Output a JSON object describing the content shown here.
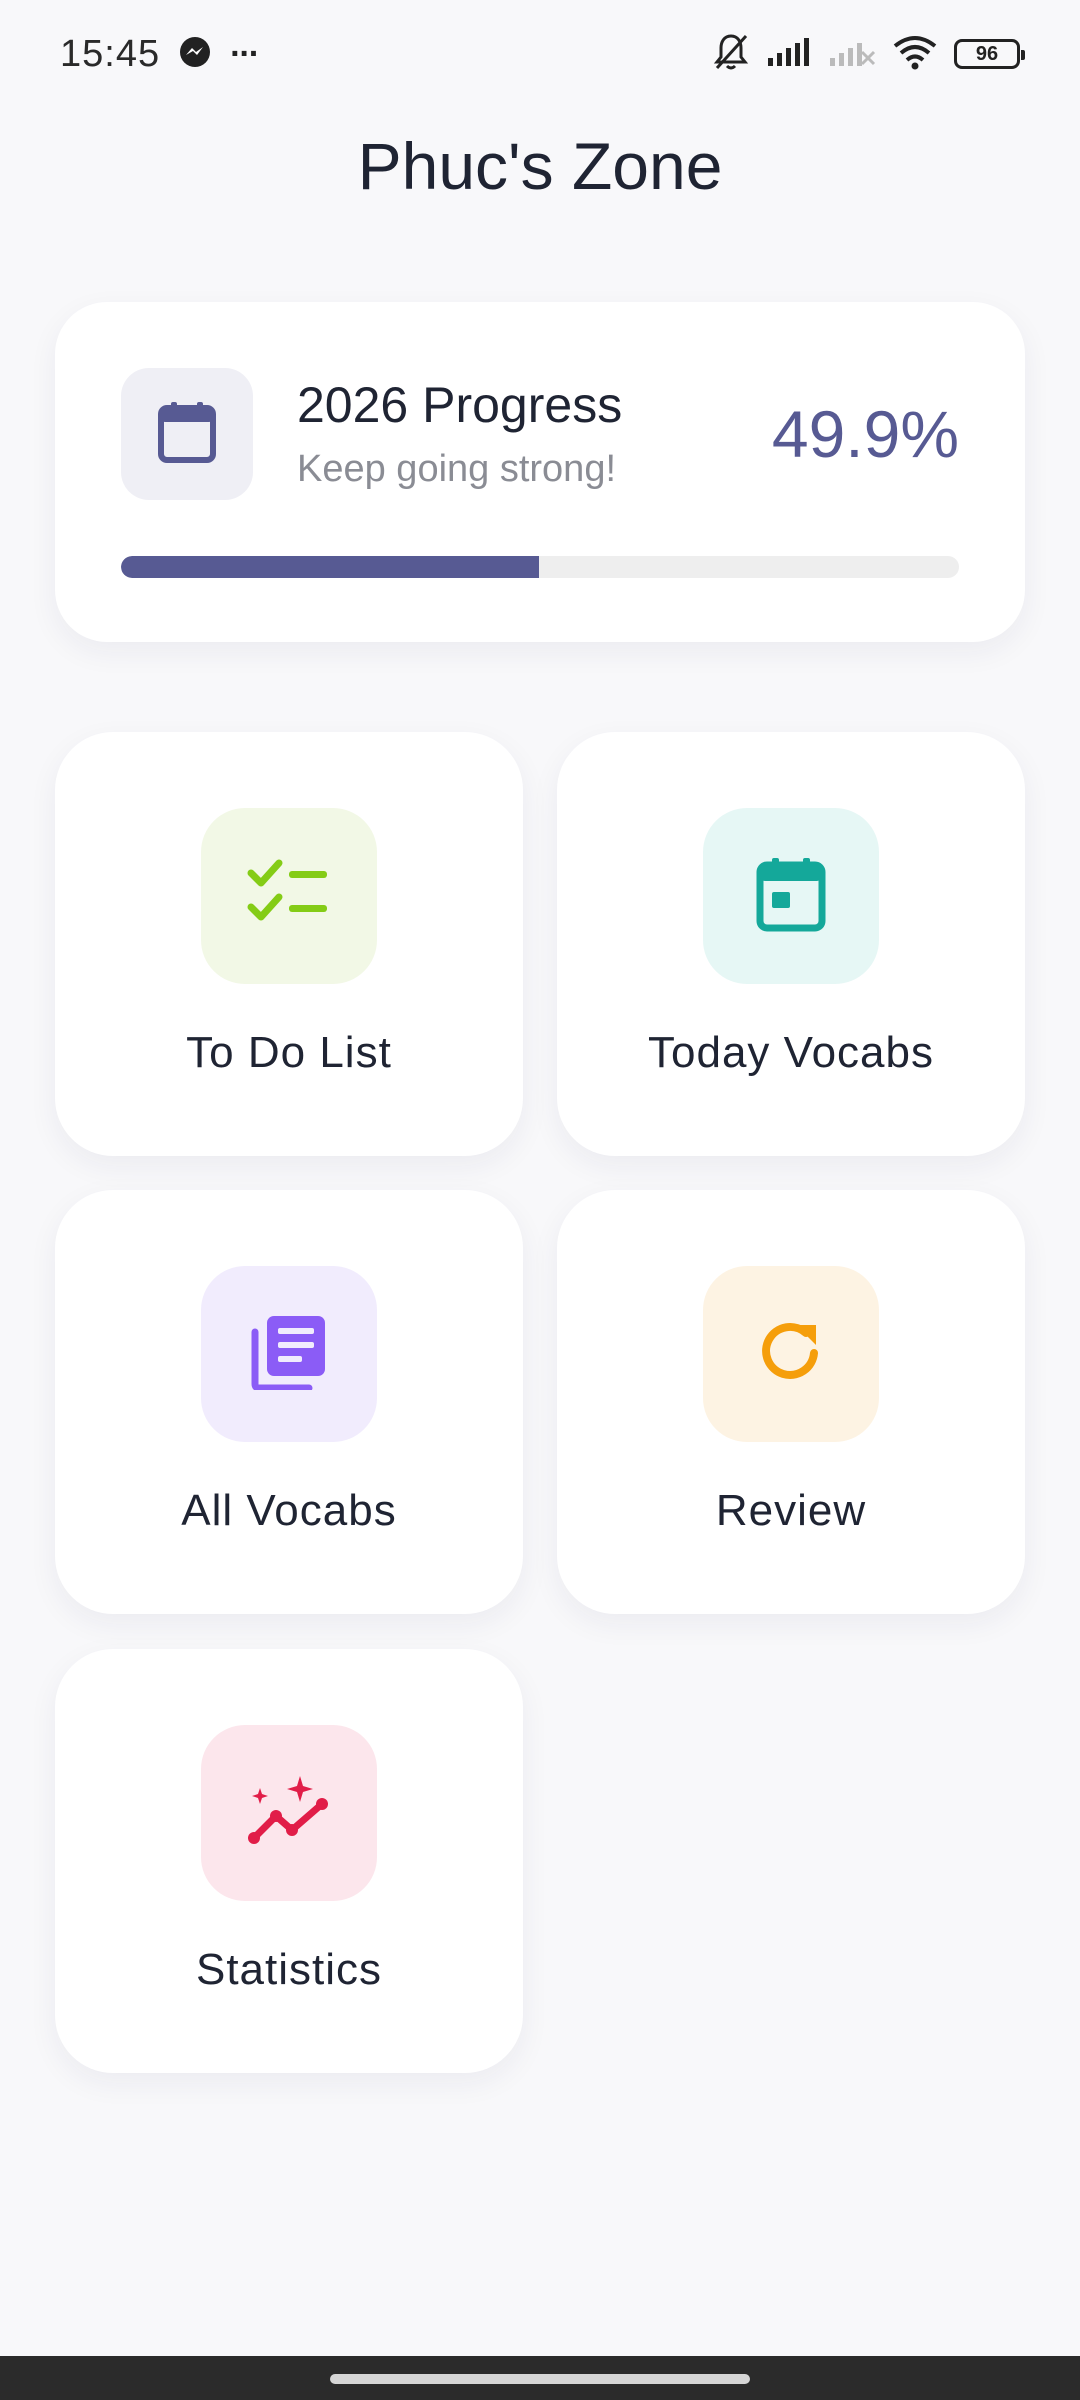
{
  "status_bar": {
    "time": "15:45",
    "more": "···",
    "battery": "96",
    "icons": [
      "messenger-icon",
      "bell-off-icon",
      "signal-icon",
      "signal-no-service-icon",
      "wifi-icon",
      "battery-icon"
    ]
  },
  "header": {
    "title": "Phuc's Zone"
  },
  "progress": {
    "title": "2026 Progress",
    "subtitle": "Keep going strong!",
    "percent_text": "49.9%",
    "fraction": 0.499,
    "icon": "calendar-icon",
    "color": "#575a93"
  },
  "tiles": [
    {
      "label": "To Do List",
      "icon": "checklist-icon",
      "color": "#84cc16",
      "bg": "#f2f8e6"
    },
    {
      "label": "Today Vocabs",
      "icon": "calendar-today-icon",
      "color": "#14a89a",
      "bg": "#e6f7f5"
    },
    {
      "label": "All Vocabs",
      "icon": "library-books-icon",
      "color": "#8b5cf6",
      "bg": "#f1ecfd"
    },
    {
      "label": "Review",
      "icon": "refresh-icon",
      "color": "#f59e0b",
      "bg": "#fdf3e3"
    },
    {
      "label": "Statistics",
      "icon": "trend-sparkle-icon",
      "color": "#e11d48",
      "bg": "#fce6ec"
    }
  ]
}
